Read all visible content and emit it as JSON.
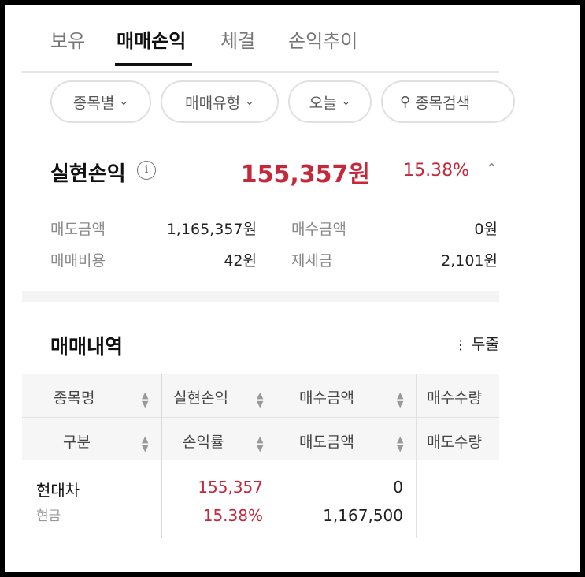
{
  "tabs": [
    {
      "label": "보유"
    },
    {
      "label": "매매손익"
    },
    {
      "label": "체결"
    },
    {
      "label": "손익추이"
    }
  ],
  "filters": {
    "by_stock": "종목별",
    "trade_type": "매매유형",
    "period": "오늘",
    "search": "종목검색"
  },
  "realized": {
    "title": "실현손익",
    "amount": "155,357원",
    "rate": "15.38%",
    "sell_amount_label": "매도금액",
    "sell_amount": "1,165,357원",
    "buy_amount_label": "매수금액",
    "buy_amount": "0원",
    "fee_label": "매매비용",
    "fee": "42원",
    "tax_label": "제세금",
    "tax": "2,101원"
  },
  "history": {
    "title": "매매내역",
    "more": "두줄",
    "headers_row1": [
      "종목명",
      "실현손익",
      "매수금액",
      "매수수량"
    ],
    "headers_row2": [
      "구분",
      "손익률",
      "매도금액",
      "매도수량"
    ],
    "rows": [
      {
        "name": "현대차",
        "type": "현금",
        "pnl": "155,357",
        "rate": "15.38%",
        "buy_amount": "0",
        "sell_amount": "1,167,500"
      }
    ]
  },
  "colors": {
    "profit_red": "#c6283b",
    "text_dark": "#111111",
    "text_muted": "#8a8a8a"
  }
}
